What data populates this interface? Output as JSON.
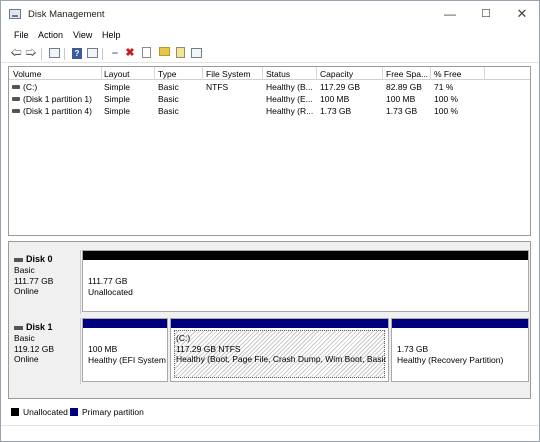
{
  "window": {
    "title": "Disk Management"
  },
  "menu": [
    "File",
    "Action",
    "View",
    "Help"
  ],
  "toolbar": {
    "buttons": [
      "back-arrow",
      "forward-arrow",
      "console-tree",
      "help",
      "properties",
      "connect",
      "delete",
      "check",
      "open",
      "export"
    ]
  },
  "volumes": {
    "columns": [
      "Volume",
      "Layout",
      "Type",
      "File System",
      "Status",
      "Capacity",
      "Free Spa...",
      "% Free"
    ],
    "rows": [
      [
        "(C:)",
        "Simple",
        "Basic",
        "NTFS",
        "Healthy (B...",
        "117.29 GB",
        "82.89 GB",
        "71 %"
      ],
      [
        "(Disk 1 partition 1)",
        "Simple",
        "Basic",
        "",
        "Healthy (E...",
        "100 MB",
        "100 MB",
        "100 %"
      ],
      [
        "(Disk 1 partition 4)",
        "Simple",
        "Basic",
        "",
        "Healthy (R...",
        "1.73 GB",
        "1.73 GB",
        "100 %"
      ]
    ]
  },
  "disks": [
    {
      "name": "Disk 0",
      "type": "Basic",
      "size": "111.77 GB",
      "state": "Online",
      "partitions": [
        {
          "line1": "111.77 GB",
          "line2": "Unallocated",
          "line3": ""
        }
      ]
    },
    {
      "name": "Disk 1",
      "type": "Basic",
      "size": "119.12 GB",
      "state": "Online",
      "partitions": [
        {
          "line1": "100 MB",
          "line2": "Healthy (EFI System",
          "line3": ""
        },
        {
          "line1": "(C:)",
          "line2": "117.29 GB NTFS",
          "line3": "Healthy (Boot, Page File, Crash Dump, Wim Boot, Basic D"
        },
        {
          "line1": "1.73 GB",
          "line2": "Healthy (Recovery Partition)",
          "line3": ""
        }
      ]
    }
  ],
  "legend": [
    {
      "label": "Unallocated",
      "color": "#000000"
    },
    {
      "label": "Primary partition",
      "color": "#00007f"
    }
  ],
  "colors": {
    "unallocated": "#000000",
    "primary": "#00007f"
  }
}
